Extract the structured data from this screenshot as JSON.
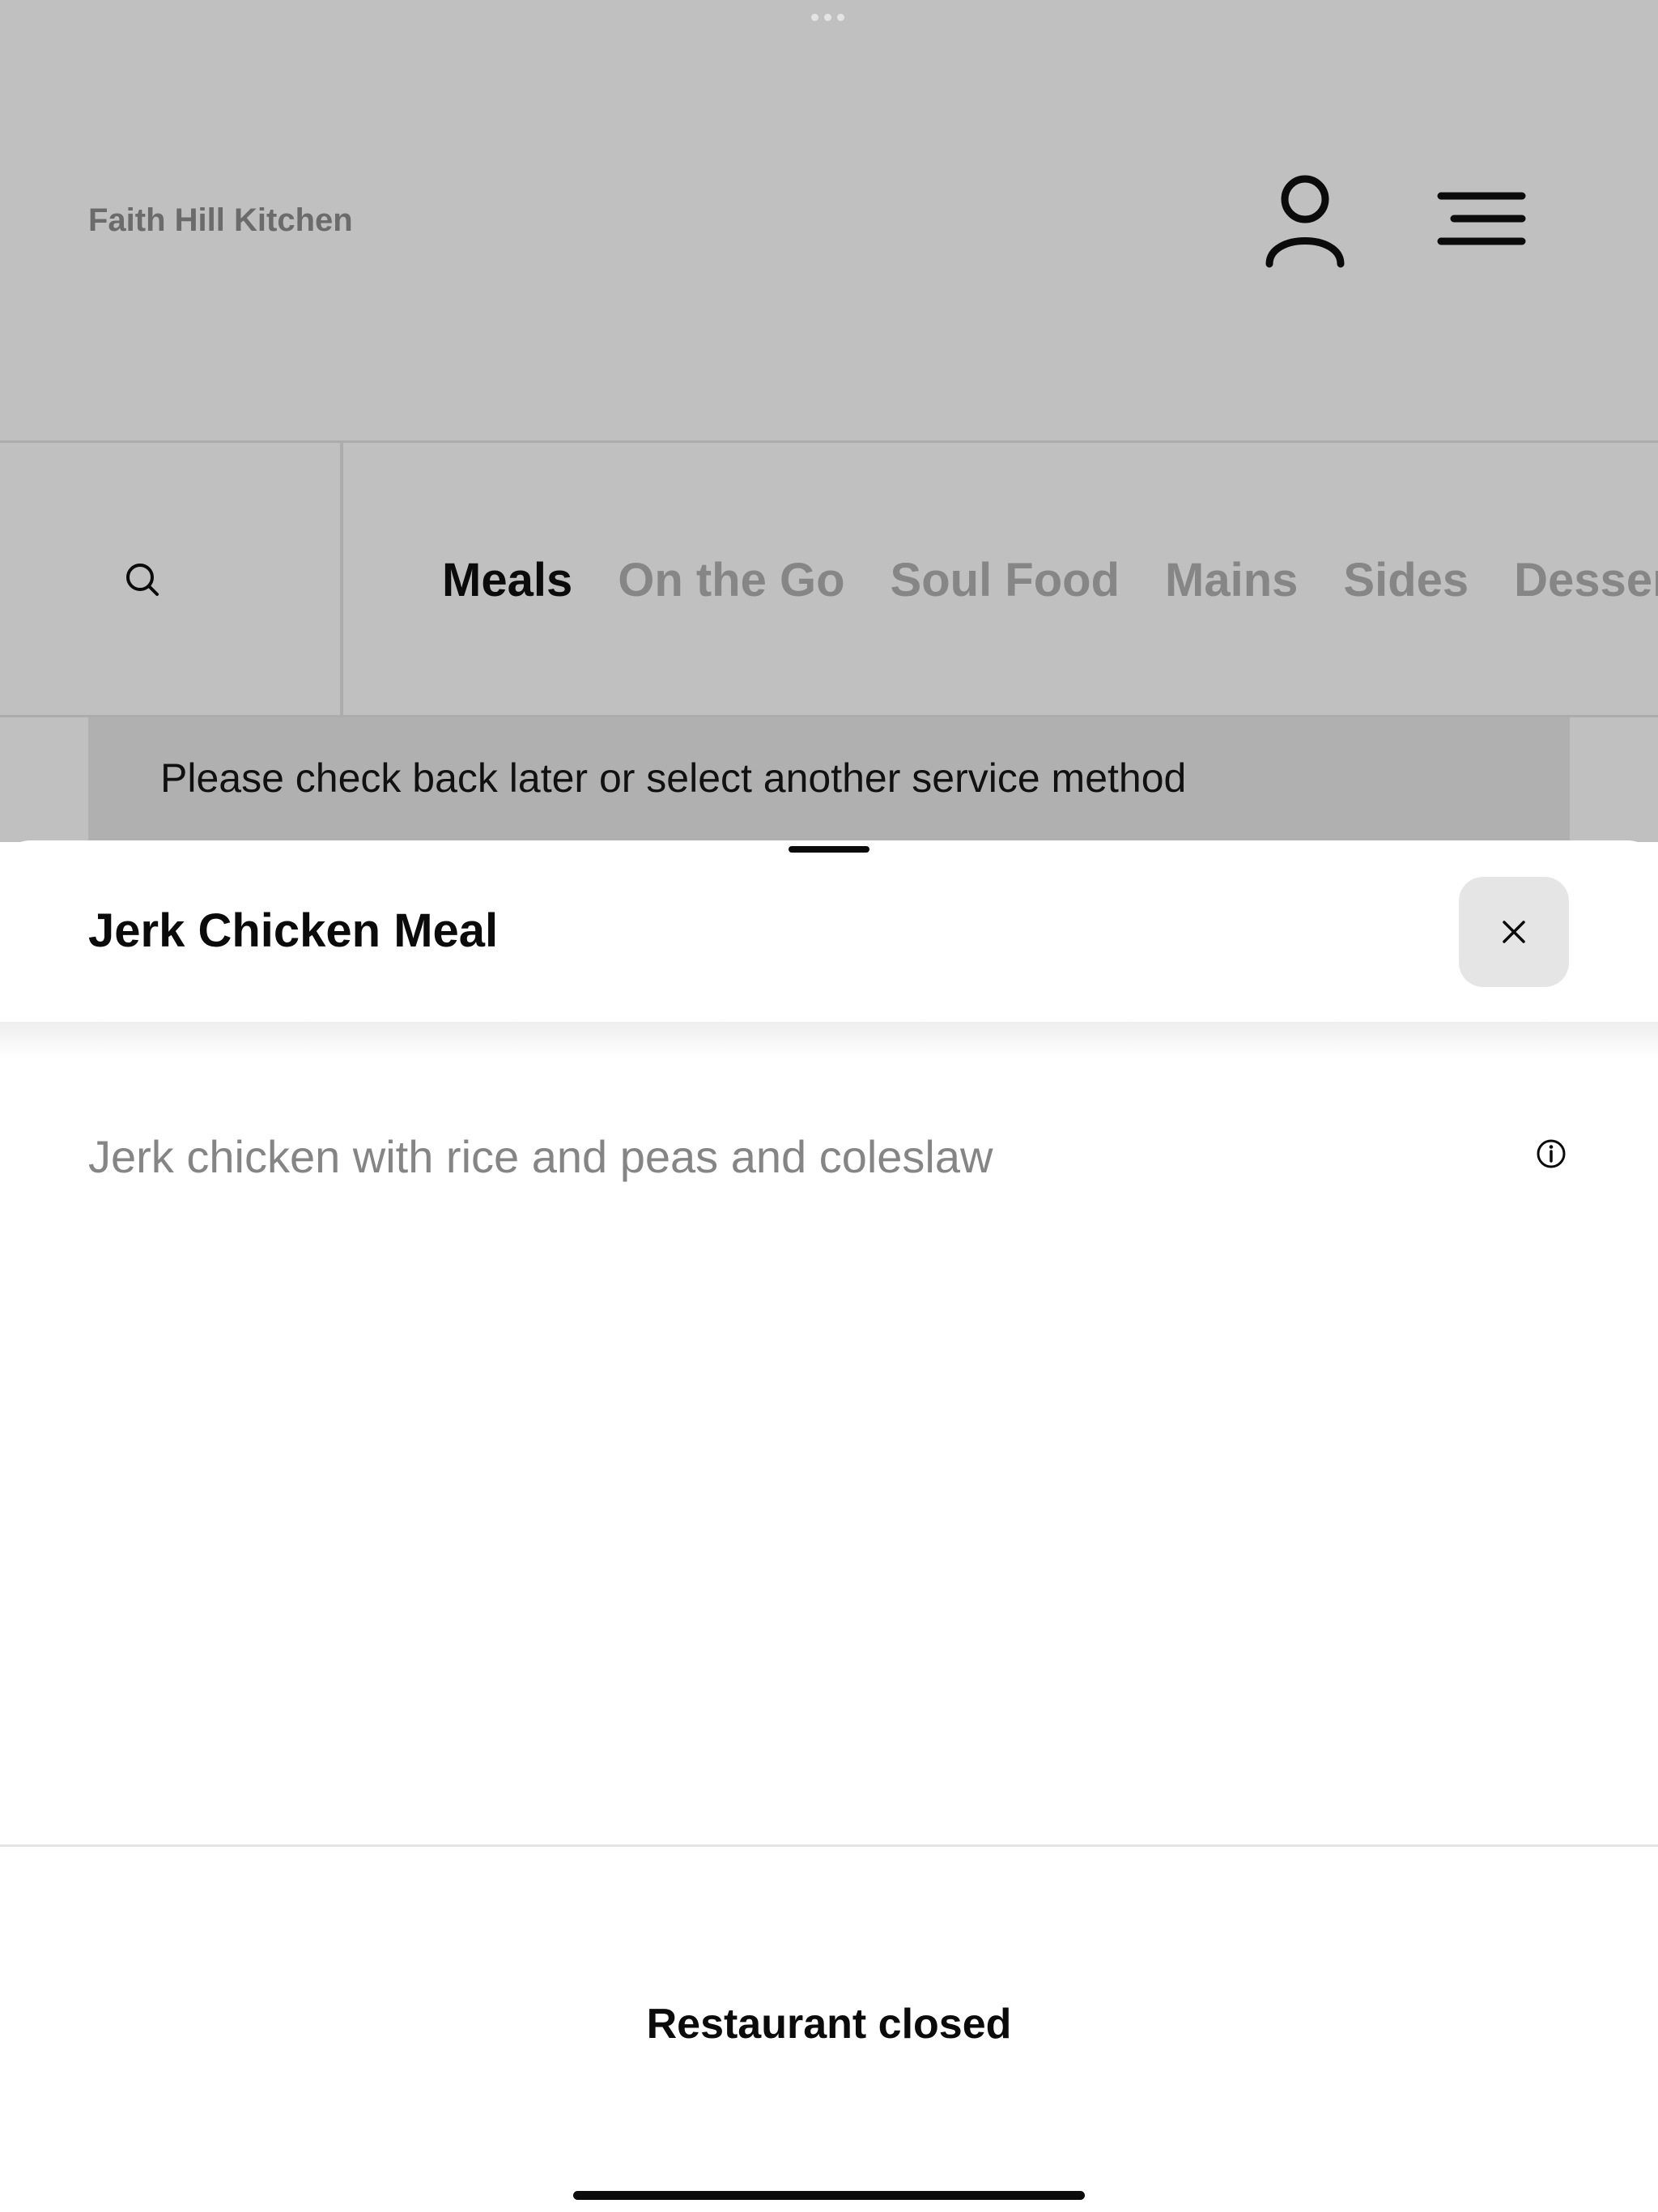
{
  "header": {
    "brand": "Faith Hill Kitchen",
    "account_icon": "user-icon",
    "menu_icon": "hamburger-menu-icon"
  },
  "categories": {
    "search_icon": "search-icon",
    "tabs": [
      {
        "label": "Meals",
        "active": true
      },
      {
        "label": "On the Go",
        "active": false
      },
      {
        "label": "Soul Food",
        "active": false
      },
      {
        "label": "Mains",
        "active": false
      },
      {
        "label": "Sides",
        "active": false
      },
      {
        "label": "Desser",
        "active": false
      }
    ]
  },
  "banner": {
    "text": "Please check back later or select another service method"
  },
  "item_sheet": {
    "title": "Jerk Chicken Meal",
    "description": "Jerk chicken with rice and peas and coleslaw",
    "close_icon": "close-icon",
    "info_icon": "info-icon",
    "status_label": "Restaurant closed"
  },
  "colors": {
    "overlay_background": "#c0c0c0",
    "sheet_background": "#ffffff",
    "active_tab": "#0b0b0b",
    "inactive_tab": "#868686",
    "description_text": "#858585"
  }
}
